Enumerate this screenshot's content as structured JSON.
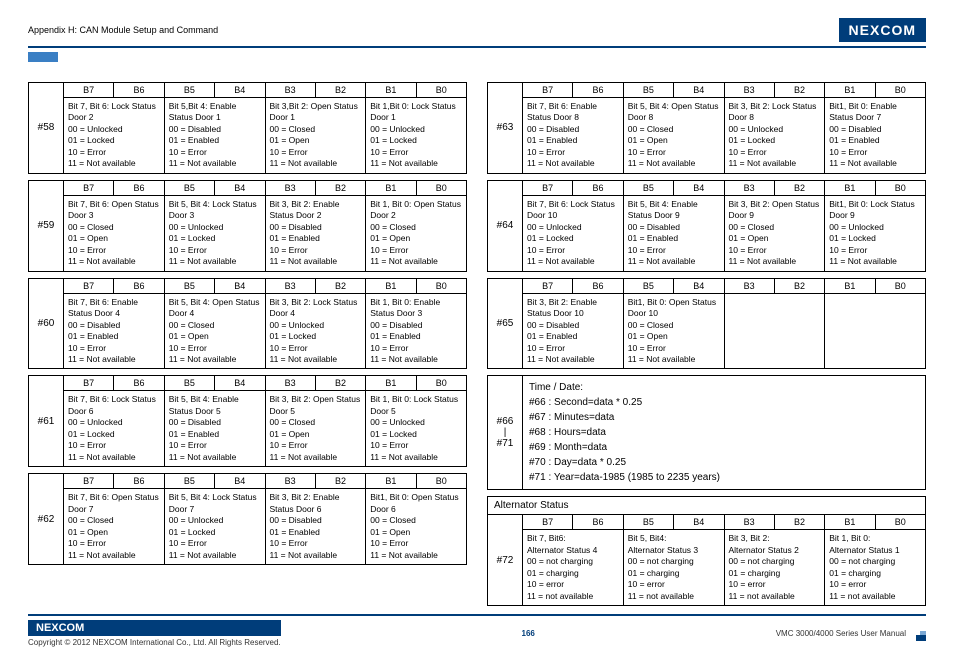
{
  "header": {
    "title": "Appendix H: CAN Module Setup and Command",
    "logo": "NEXCOM"
  },
  "footer": {
    "logo": "NEXCOM",
    "copyright": "Copyright © 2012 NEXCOM International Co., Ltd. All Rights Reserved.",
    "page": "166",
    "manual": "VMC 3000/4000 Series User Manual"
  },
  "bits": [
    "B7",
    "B6",
    "B5",
    "B4",
    "B3",
    "B2",
    "B1",
    "B0"
  ],
  "left": [
    {
      "id": "#58",
      "cells": [
        "Bit 7, Bit 6: Lock Status Door 2\n00 = Unlocked\n01 = Locked\n10 = Error\n11 = Not available",
        "Bit 5,Bit 4: Enable Status Door 1\n00 = Disabled\n01 = Enabled\n10 = Error\n11 = Not available",
        "Bit 3,Bit 2: Open Status Door 1\n00 = Closed\n01 = Open\n10 = Error\n11 = Not available",
        "Bit 1,Bit 0: Lock Status Door 1\n00 = Unlocked\n01 = Locked\n10 = Error\n11 = Not available"
      ]
    },
    {
      "id": "#59",
      "cells": [
        "Bit 7, Bit 6: Open Status Door 3\n00 = Closed\n01 = Open\n10 = Error\n11 = Not available",
        "Bit 5, Bit 4: Lock Status Door 3\n00 = Unlocked\n01 = Locked\n10 = Error\n11 = Not available",
        "Bit 3, Bit 2: Enable Status Door 2\n00 = Disabled\n01 = Enabled\n10 = Error\n11 = Not available",
        "Bit 1, Bit 0: Open Status Door 2\n00 = Closed\n01 = Open\n10 = Error\n11 = Not available"
      ]
    },
    {
      "id": "#60",
      "cells": [
        "Bit 7, Bit 6: Enable Status Door 4\n00 = Disabled\n01 = Enabled\n10 = Error\n11 = Not available",
        "Bit 5, Bit 4: Open Status Door 4\n00 = Closed\n01 = Open\n10 = Error\n11 = Not available",
        "Bit 3, Bit 2: Lock Status Door 4\n00 = Unlocked\n01 = Locked\n10 = Error\n11 = Not available",
        "Bit 1, Bit 0: Enable Status Door 3\n00 = Disabled\n01 = Enabled\n10 = Error\n11 = Not available"
      ]
    },
    {
      "id": "#61",
      "cells": [
        "Bit 7, Bit 6: Lock Status Door 6\n00 = Unlocked\n01 = Locked\n10 = Error\n11 = Not available",
        "Bit 5, Bit 4: Enable Status Door 5\n00 = Disabled\n01 = Enabled\n10 = Error\n11 = Not available",
        "Bit 3, Bit 2: Open Status Door 5\n00 = Closed\n01 = Open\n10 = Error\n11 = Not available",
        "Bit 1, Bit 0: Lock Status Door 5\n00 = Unlocked\n01 = Locked\n10 = Error\n11 = Not available"
      ]
    },
    {
      "id": "#62",
      "cells": [
        "Bit 7, Bit 6: Open Status Door 7\n00 = Closed\n01 = Open\n10 = Error\n11 = Not available",
        "Bit 5, Bit 4: Lock Status Door 7\n00 = Unlocked\n01 = Locked\n10 = Error\n11 = Not available",
        "Bit 3, Bit 2: Enable Status Door 6\n00 = Disabled\n01 = Enabled\n10 = Error\n11 = Not available",
        "Bit1, Bit 0: Open Status Door 6\n00 = Closed\n01 = Open\n10 = Error\n11 = Not available"
      ]
    }
  ],
  "right": [
    {
      "id": "#63",
      "cells": [
        "Bit 7, Bit 6: Enable Status Door 8\n00 = Disabled\n01 = Enabled\n10 = Error\n11 = Not available",
        "Bit 5, Bit 4: Open Status Door 8\n00 = Closed\n01 = Open\n10 = Error\n11 = Not available",
        "Bit 3, Bit 2: Lock Status Door 8\n00 = Unlocked\n01 = Locked\n10 = Error\n11 = Not available",
        "Bit1, Bit 0: Enable Status Door 7\n00 = Disabled\n01 = Enabled\n10 = Error\n11 = Not available"
      ]
    },
    {
      "id": "#64",
      "cells": [
        "Bit 7, Bit 6: Lock Status Door 10\n00 = Unlocked\n01 = Locked\n10 = Error\n11 = Not available",
        "Bit 5, Bit 4: Enable Status Door 9\n00 = Disabled\n01 = Enabled\n10 = Error\n11 = Not available",
        "Bit 3, Bit 2: Open Status Door 9\n00 = Closed\n01 = Open\n10 = Error\n11 = Not available",
        "Bit1, Bit 0: Lock Status Door 9\n00 = Unlocked\n01 = Locked\n10 = Error\n11 = Not available"
      ]
    },
    {
      "id": "#65",
      "partial": true,
      "cells": [
        "Bit 3, Bit 2: Enable Status Door 10\n00 = Disabled\n01 = Enabled\n10 = Error\n11 = Not available",
        "Bit1, Bit 0: Open Status Door 10\n00 = Closed\n01 = Open\n10 = Error\n11 = Not available",
        "",
        ""
      ]
    }
  ],
  "timedate": {
    "id": "#66\n|\n#71",
    "title": "Time / Date:",
    "lines": [
      "#66 : Second=data * 0.25",
      "#67 : Minutes=data",
      "#68 : Hours=data",
      "#69 : Month=data",
      "#70 : Day=data * 0.25",
      "#71 : Year=data-1985 (1985 to 2235 years)"
    ]
  },
  "alt": {
    "title": "Alternator Status",
    "id": "#72",
    "cells": [
      "Bit 7, Bit6:\nAlternator Status 4\n00 = not charging\n01 = charging\n10 = error\n11 = not available",
      "Bit 5, Bit4:\nAlternator Status 3\n00 = not charging\n01 = charging\n10 = error\n11 = not available",
      "Bit 3, Bit 2:\nAlternator Status 2\n00 = not charging\n01 = charging\n10 = error\n11 = not available",
      "Bit 1, Bit 0:\nAlternator Status 1\n00 = not charging\n01 = charging\n10 = error\n11 = not available"
    ]
  }
}
